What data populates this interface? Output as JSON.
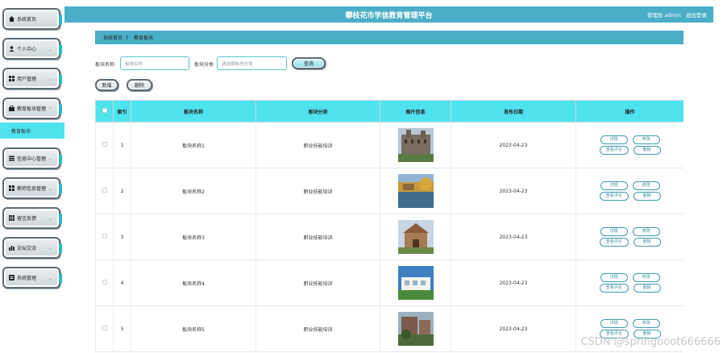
{
  "sidebar": {
    "items": [
      {
        "label": "系统首页",
        "icon": "home-icon",
        "chevron": false
      },
      {
        "label": "个人中心",
        "icon": "user-icon",
        "chevron": true
      },
      {
        "label": "用户管理",
        "icon": "grid-icon",
        "chevron": true
      },
      {
        "label": "教育板块管理",
        "icon": "briefcase-icon",
        "chevron": true
      },
      {
        "label": "信息中心管理",
        "icon": "list-icon",
        "chevron": true
      },
      {
        "label": "教师信息管理",
        "icon": "grid-icon",
        "chevron": true
      },
      {
        "label": "留言反馈",
        "icon": "grid-icon",
        "chevron": true
      },
      {
        "label": "论坛交流",
        "icon": "chart-icon",
        "chevron": true
      },
      {
        "label": "系统管理",
        "icon": "settings-icon",
        "chevron": true
      }
    ],
    "active_sub_item": "教育板块"
  },
  "header": {
    "title": "攀枝花市学信教育管理平台",
    "user_role": "管理员 admin",
    "logout": "退出登录"
  },
  "breadcrumb": {
    "home": "系统首页",
    "separator": "》",
    "current": "教育板块"
  },
  "search": {
    "name_label": "板块名称",
    "name_placeholder": "板块名称",
    "category_label": "板块分类",
    "category_placeholder": "请选择板块分类",
    "search_button": "查询"
  },
  "toolbar": {
    "add_button": "新增",
    "delete_button": "删除"
  },
  "table": {
    "headers": [
      "",
      "索引",
      "板块名称",
      "板块分类",
      "图片信息",
      "发布日期",
      "操作"
    ],
    "rows": [
      {
        "index": "1",
        "name": "板块名称1",
        "category": "职业技能培训",
        "date": "2023-04-23",
        "image": "campus-building"
      },
      {
        "index": "2",
        "name": "板块名称2",
        "category": "职业技能培训",
        "date": "2023-04-23",
        "image": "campus-lake"
      },
      {
        "index": "3",
        "name": "板块名称3",
        "category": "职业技能培训",
        "date": "2023-04-23",
        "image": "campus-hall"
      },
      {
        "index": "4",
        "name": "板块名称4",
        "category": "职业技能培训",
        "date": "2023-04-23",
        "image": "campus-modern"
      },
      {
        "index": "5",
        "name": "板块名称5",
        "category": "职业技能培训",
        "date": "2023-04-23",
        "image": "campus-garden"
      }
    ],
    "actions": {
      "detail": "详情",
      "edit": "修改",
      "view_comments": "查看评论",
      "delete": "删除"
    }
  },
  "watermark": "CSDN @springboot666666",
  "colors": {
    "header": "#4aaec6",
    "table_header": "#4fe3ee",
    "active_sub_item": "#4fe3ee",
    "accent_border": "#3e9cae"
  }
}
